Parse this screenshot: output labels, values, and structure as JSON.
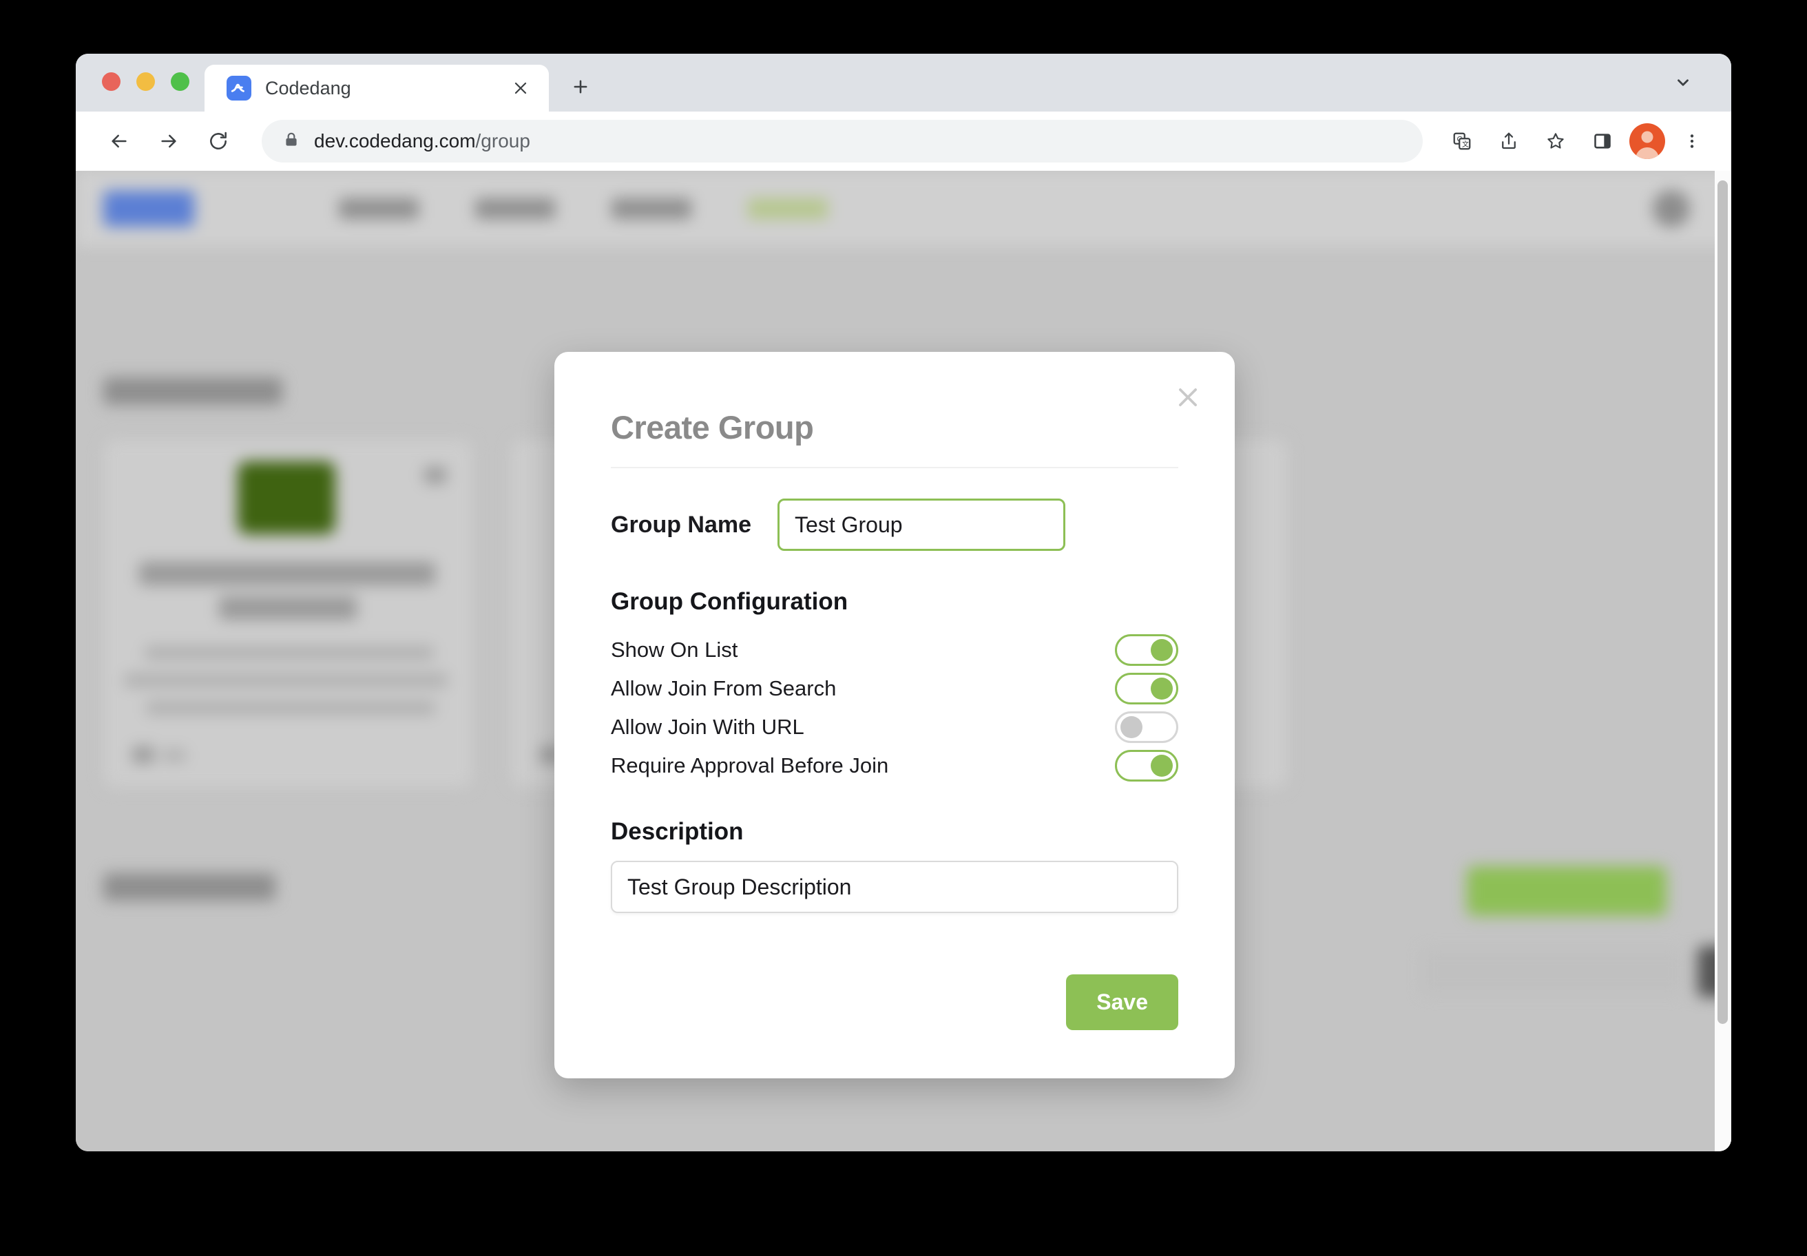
{
  "browser": {
    "tab": {
      "title": "Codedang",
      "favicon": "codedang-logo-icon",
      "close": "×"
    },
    "new_tab_label": "+",
    "tab_search": "chevron-down-icon",
    "toolbar": {
      "back": "back-arrow-icon",
      "forward": "forward-arrow-icon",
      "reload": "reload-icon",
      "lock": "lock-icon",
      "url_domain": "dev.codedang.com",
      "url_path": "/group",
      "translate": "translate-icon",
      "share": "share-icon",
      "bookmark": "star-icon",
      "side_panel": "side-panel-icon",
      "profile": "avatar-icon",
      "menu": "three-dot-menu-icon"
    },
    "traffic_lights": {
      "close": "#e8645a",
      "minimize": "#f2bd42",
      "zoom": "#4fc04a"
    }
  },
  "modal": {
    "title": "Create Group",
    "close_icon": "close-icon",
    "group_name": {
      "label": "Group Name",
      "value": "Test Group",
      "placeholder": "Group Name"
    },
    "configuration": {
      "title": "Group Configuration",
      "items": [
        {
          "label": "Show On List",
          "enabled": true
        },
        {
          "label": "Allow Join From Search",
          "enabled": true
        },
        {
          "label": "Allow Join With URL",
          "enabled": false
        },
        {
          "label": "Require Approval Before Join",
          "enabled": true
        }
      ]
    },
    "description": {
      "label": "Description",
      "value": "Test Group Description",
      "placeholder": "Description"
    },
    "save_label": "Save"
  },
  "colors": {
    "accent_green": "#8dc055",
    "toggle_off_gray": "#c9c9c9",
    "title_gray": "#8a8a8a",
    "page_background": "#c4c4c4"
  }
}
